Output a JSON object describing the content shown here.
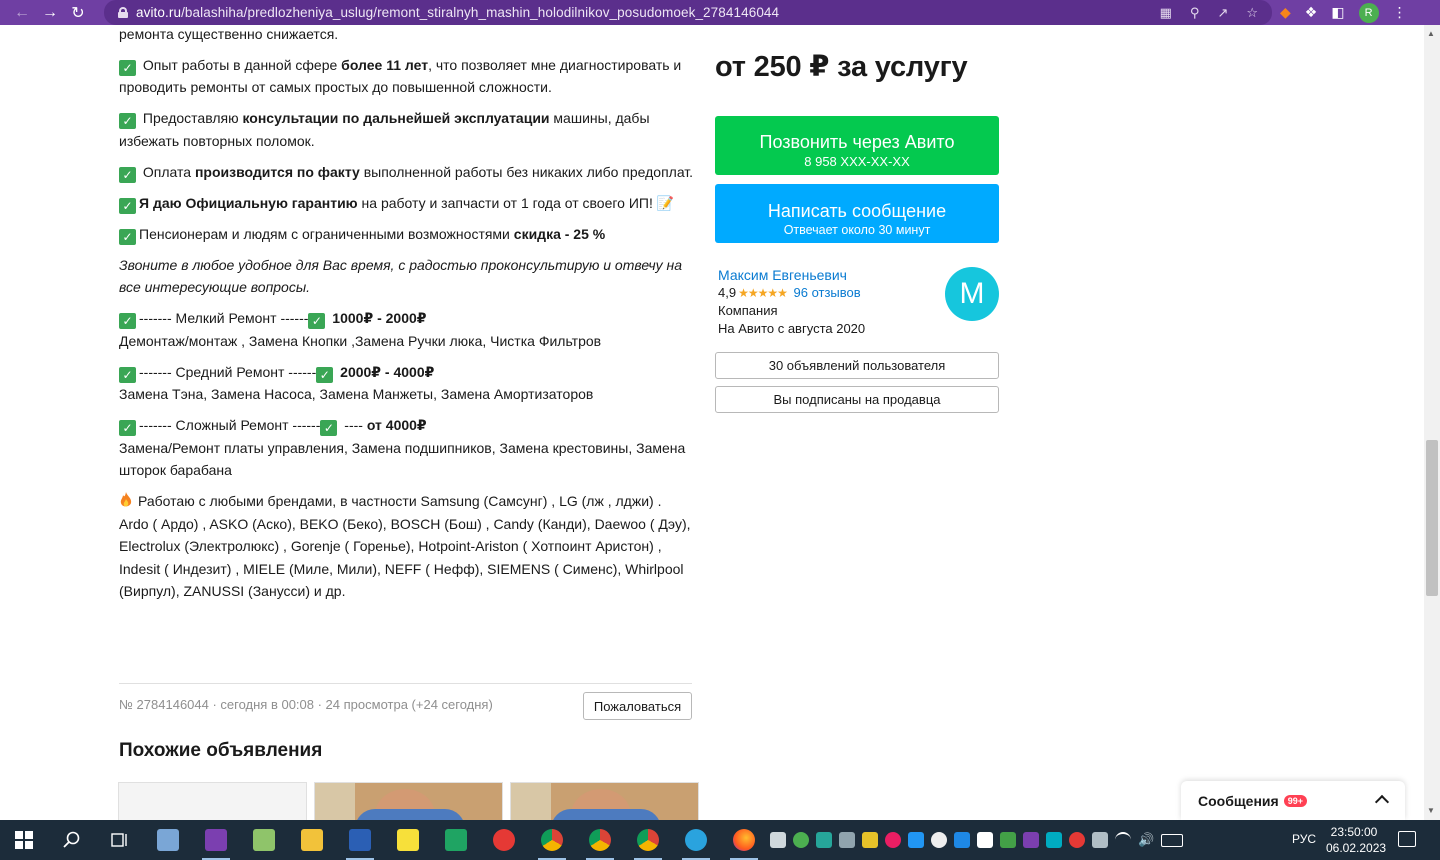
{
  "browser": {
    "url_host": "avito.ru",
    "url_path": "/balashiha/predlozheniya_uslug/remont_stiralnyh_mashin_holodilnikov_posudomoek_2784146044",
    "profile_initial": "R"
  },
  "description": {
    "line_top": "ремонта существенно снижается.",
    "p1_pre": " Опыт работы в данной сфере ",
    "p1_bold": "более 11 лет",
    "p1_post": ", что позволяет мне диагностировать и проводить ремонты от самых простых до повышенной сложности.",
    "p2_pre": " Предоставляю ",
    "p2_bold": "консультации по дальнейшей эксплуатации",
    "p2_post": " машины, дабы избежать повторных поломок.",
    "p3_pre": " Оплата ",
    "p3_bold": "производится по факту",
    "p3_post": " выполненной работы без никаких либо предоплат.",
    "p4_bold": "Я даю Официальную гарантию",
    "p4_post": " на работу и запчасти от 1 года от своего ИП! 📝",
    "p5_pre": "Пенсионерам и людям с ограниченными возможностями ",
    "p5_bold": "скидка - 25 %",
    "p6_italic": "Звоните в любое удобное для Вас время, с радостью проконсультирую и отвечу на все интересующие вопросы.",
    "small_pre": "------- Мелкий Ремонт ------",
    "small_price": " 1000₽ - 2000₽",
    "small_list": "Демонтаж/монтаж , Замена Кнопки ,Замена Ручки люка, Чистка Фильтров",
    "medium_pre": "------- Средний Ремонт ------",
    "medium_price": " 2000₽ - 4000₽",
    "medium_list": "Замена Тэна, Замена Насоса, Замена Манжеты, Замена Амортизаторов",
    "hard_pre": "------- Сложный Ремонт ------",
    "hard_mid": " ---- ",
    "hard_price": "от 4000₽",
    "hard_list": "Замена/Ремонт платы управления, Замена подшипников, Замена крестовины, Замена шторок барабана",
    "brands": "Работаю с любыми брендами, в частности Samsung (Самсунг) , LG (лж , лджи) . Ardo ( Ардо) , ASKO (Аско), BEKO (Беко), BOSCH (Бош) , Candy (Канди), Daewoo ( Дэу), Electrolux (Электролюкс) , Gorenje ( Горенье), Hotpoint-Ariston ( Хотпоинт Аристон) , Indesit ( Индезит) , MIELE (Миле, Мили), NEFF ( Нефф), SIEMENS ( Сименс), Whirlpool (Вирпул), ZANUSSI (Занусси) и др."
  },
  "listing_meta": {
    "info": "№ 2784146044 · сегодня в 00:08 · 24 просмотра (+24 сегодня)",
    "complain_label": "Пожаловаться",
    "similar_title": "Похожие объявления"
  },
  "sidebar": {
    "price": "от 250 ₽ за услугу",
    "call_label": "Позвонить через Авито",
    "call_phone": "8 958 XXX-XX-XX",
    "message_label": "Написать сообщение",
    "message_sub": "Отвечает около 30 минут",
    "seller_name": "Максим Евгеньевич",
    "seller_rating": "4,9",
    "seller_stars": "★★★★★",
    "seller_reviews": "96 отзывов",
    "seller_type": "Компания",
    "seller_since": "На Авито с августа 2020",
    "seller_avatar_letter": "M",
    "listings_button": "30 объявлений пользователя",
    "subscribed_button": "Вы подписаны на продавца"
  },
  "messages_widget": {
    "label": "Сообщения",
    "badge": "99+"
  },
  "taskbar": {
    "lang": "РУС",
    "time": "23:50:00",
    "date": "06.02.2023"
  },
  "colors": {
    "browser_bar": "#6f3fa3",
    "call_green": "#04c94f",
    "message_blue": "#00aaff",
    "link_blue": "#0a7bd1",
    "avatar_cyan": "#16c6dd"
  }
}
